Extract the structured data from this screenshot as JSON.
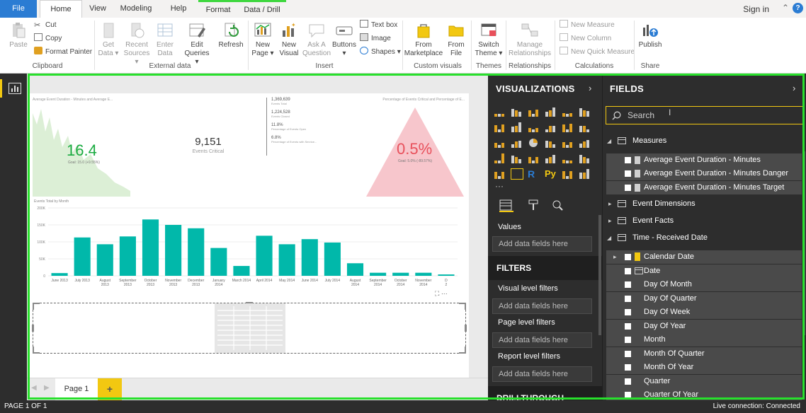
{
  "tabs": [
    {
      "label": "File"
    },
    {
      "label": "Home"
    },
    {
      "label": "View"
    },
    {
      "label": "Modeling"
    },
    {
      "label": "Help"
    },
    {
      "label": "Format"
    },
    {
      "label": "Data / Drill"
    }
  ],
  "signin": "Sign in",
  "ribbon": {
    "clipboard": {
      "paste": "Paste",
      "cut": "Cut",
      "copy": "Copy",
      "format_painter": "Format Painter",
      "group": "Clipboard"
    },
    "external": {
      "get_data": [
        "Get",
        "Data ▾"
      ],
      "recent_sources": [
        "Recent",
        "Sources ▾"
      ],
      "enter_data": [
        "Enter",
        "Data"
      ],
      "edit_queries": [
        "Edit",
        "Queries ▾"
      ],
      "refresh": "Refresh",
      "group": "External data"
    },
    "insert": {
      "new_page": [
        "New",
        "Page ▾"
      ],
      "new_visual": [
        "New",
        "Visual"
      ],
      "ask_question": [
        "Ask A",
        "Question"
      ],
      "buttons": [
        "Buttons",
        "▾"
      ],
      "text_box": "Text box",
      "image": "Image",
      "shapes": "Shapes ▾",
      "group": "Insert"
    },
    "custom": {
      "from_marketplace": [
        "From",
        "Marketplace"
      ],
      "from_file": [
        "From",
        "File"
      ],
      "group": "Custom visuals"
    },
    "themes": {
      "switch_theme": [
        "Switch",
        "Theme ▾"
      ],
      "group": "Themes"
    },
    "relationships": {
      "manage": [
        "Manage",
        "Relationships"
      ],
      "group": "Relationships"
    },
    "calculations": {
      "new_measure": "New Measure",
      "new_column": "New Column",
      "new_quick_measure": "New Quick Measure",
      "group": "Calculations"
    },
    "share": {
      "publish": "Publish",
      "group": "Share"
    }
  },
  "report": {
    "area_title": "Average Event Duration - Minutes and Average E...",
    "kpi_value": "16.4",
    "kpi_goal": "Goal: 15.0 (+9.55%)",
    "card_value": "9,151",
    "card_label": "Events Critical",
    "multi": [
      {
        "value": "1,369,639",
        "label": "Events Total"
      },
      {
        "value": "1,224,528",
        "label": "Events Closed"
      },
      {
        "value": "11.8%",
        "label": "Percentage of Events Open"
      },
      {
        "value": "6.8%",
        "label": "Percentage of Events with Service..."
      }
    ],
    "tri_title": "Percentage of Events Critical and Percentage of E...",
    "tri_value": "0.5%",
    "tri_goal": "Goal: 5.0% (-89.57%)",
    "more": "···"
  },
  "chart_data": {
    "type": "bar",
    "title": "Events Total by Month",
    "categories": [
      [
        "June 2013"
      ],
      [
        "July 2013"
      ],
      [
        "August",
        "2013"
      ],
      [
        "September",
        "2013"
      ],
      [
        "October",
        "2013"
      ],
      [
        "November",
        "2013"
      ],
      [
        "December",
        "2013"
      ],
      [
        "January",
        "2014"
      ],
      [
        "March 2014"
      ],
      [
        "April 2014"
      ],
      [
        "May 2014"
      ],
      [
        "June 2014"
      ],
      [
        "July 2014"
      ],
      [
        "August",
        "2014"
      ],
      [
        "September",
        "2014"
      ],
      [
        "October",
        "2014"
      ],
      [
        "November",
        "2014"
      ],
      [
        "D",
        "2"
      ]
    ],
    "values": [
      8000,
      113000,
      93000,
      116000,
      166000,
      150000,
      140000,
      82000,
      29000,
      118000,
      93000,
      108000,
      98000,
      37000,
      9000,
      9000,
      9000,
      4000
    ],
    "yticks": [
      "200K",
      "150K",
      "100K",
      "50K",
      "0"
    ],
    "ylim": [
      0,
      200000
    ],
    "color": "#01b8aa"
  },
  "page_tab": "Page 1",
  "viz": {
    "header": "VISUALIZATIONS",
    "values": "Values",
    "add": "Add data fields here",
    "filters": "FILTERS",
    "visual_filters": "Visual level filters",
    "page_filters": "Page level filters",
    "report_filters": "Report level filters",
    "drill": "DRILLTHROUGH",
    "more": "···"
  },
  "fields": {
    "header": "FIELDS",
    "search_placeholder": "Search",
    "groups": [
      {
        "name": "Measures",
        "expanded": true
      },
      {
        "name": "Event Dimensions",
        "expanded": false
      },
      {
        "name": "Event Facts",
        "expanded": false
      },
      {
        "name": "Time - Received Date",
        "expanded": true
      }
    ],
    "measures": [
      "Average Event Duration - Minutes",
      "Average Event Duration - Minutes Danger",
      "Average Event Duration - Minutes Target"
    ],
    "time_items": [
      "Calendar Date",
      "Date",
      "Day Of Month",
      "Day Of Quarter",
      "Day Of Week",
      "Day Of Year",
      "Month",
      "Month Of Quarter",
      "Month Of Year",
      "Quarter",
      "Quarter Of Year"
    ]
  },
  "status": {
    "page": "PAGE 1 OF 1",
    "connection": "Live connection: Connected"
  },
  "colors": {
    "accent": "#2b7cd3",
    "teal": "#01b8aa",
    "kpi_green": "#1aab40",
    "red": "#e8505b",
    "highlight": "#28e02c",
    "yellow": "#f2c811"
  }
}
